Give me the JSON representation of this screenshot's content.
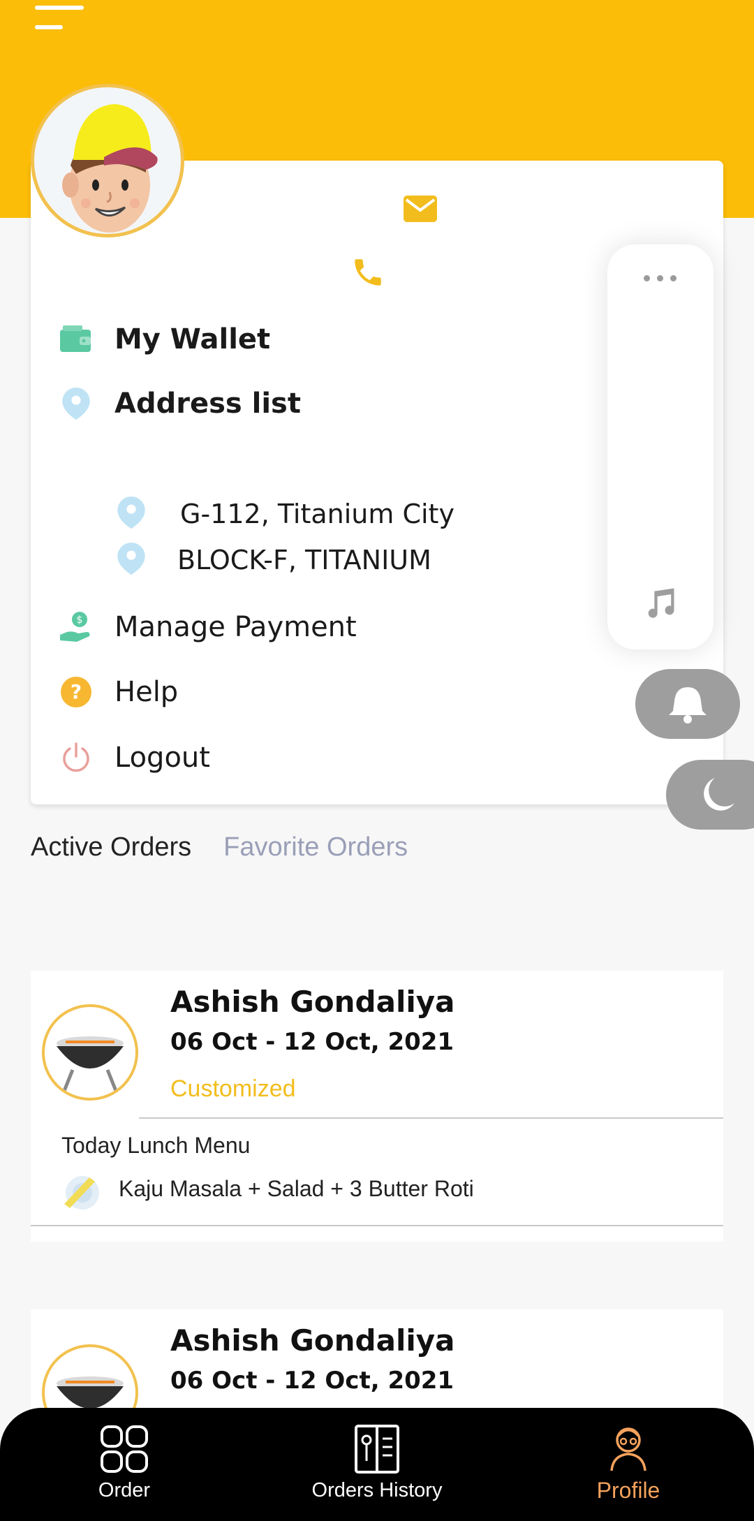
{
  "colors": {
    "accent_yellow": "#fbbd08",
    "wallet_green": "#5ac9a2",
    "pin_blue": "#bfe3f5",
    "help_orange": "#f7b731",
    "logout_red": "#e9a09b",
    "customized_yellow": "#f2bd1c",
    "nav_active": "#f5a25d"
  },
  "profile": {
    "menu": [
      {
        "label": "My Wallet",
        "icon": "wallet-icon"
      },
      {
        "label": "Address list",
        "icon": "location-pin-icon"
      },
      {
        "label": "Manage Payment",
        "icon": "payment-hand-icon"
      },
      {
        "label": "Help",
        "icon": "help-icon"
      },
      {
        "label": "Logout",
        "icon": "power-icon"
      }
    ],
    "addresses": [
      "G-112, Titanium City",
      "BLOCK-F, TITANIUM"
    ]
  },
  "tabs": {
    "active": "Active Orders",
    "favorite": "Favorite Orders"
  },
  "orders": [
    {
      "name": "Ashish Gondaliya",
      "date": "06 Oct - 12 Oct, 2021",
      "type": "Customized",
      "menu_title": "Today Lunch Menu",
      "menu_items": "Kaju Masala + Salad + 3 Butter Roti"
    },
    {
      "name": "Ashish Gondaliya",
      "date": "06 Oct - 12 Oct, 2021"
    }
  ],
  "nav": {
    "order": "Order",
    "history": "Orders History",
    "profile": "Profile"
  }
}
